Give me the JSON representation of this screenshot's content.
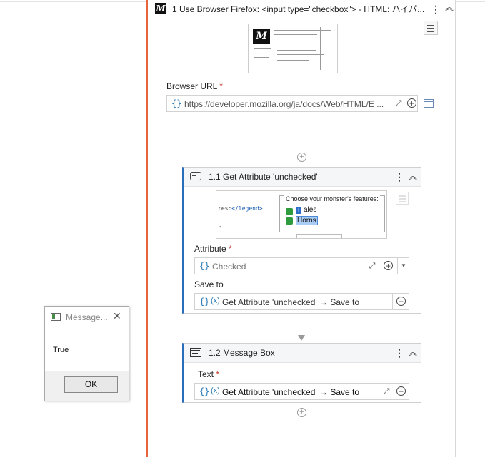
{
  "browser_scope": {
    "title": "1 Use Browser Firefox: <input type=\"checkbox\"> - HTML: ハイパ...",
    "logo_text": "M",
    "url_label": "Browser URL",
    "url_value": "https://developer.mozilla.org/ja/docs/Web/HTML/E ...",
    "required_mark": "*"
  },
  "get_attribute": {
    "title": "1.1 Get Attribute 'unchecked'",
    "snapshot": {
      "code_line1": "res:",
      "code_tag": "</legend>",
      "code_line2": "\"",
      "legend": "Choose your monster's features:",
      "item1": "ales",
      "item1_badge": "+",
      "item2": "Horns"
    },
    "attribute_label": "Attribute",
    "attribute_value": "Checked",
    "save_to_label": "Save to",
    "save_to_value": "Get Attribute 'unchecked' → Save to"
  },
  "message_box": {
    "title": "1.2 Message Box",
    "text_label": "Text",
    "text_value": "Get Attribute 'unchecked' → Save to"
  },
  "common": {
    "brace": "{}",
    "var_symbol": "(x)",
    "kebab": "⋮",
    "collapse": "︽",
    "plus": "+",
    "expand": "⤢"
  },
  "dialog": {
    "title": "Message...",
    "close": "✕",
    "message": "True",
    "ok_label": "OK"
  },
  "colors": {
    "scope_accent": "#e8643c",
    "card_accent": "#2a6ebb",
    "variable_blue": "#2a7ab5"
  }
}
